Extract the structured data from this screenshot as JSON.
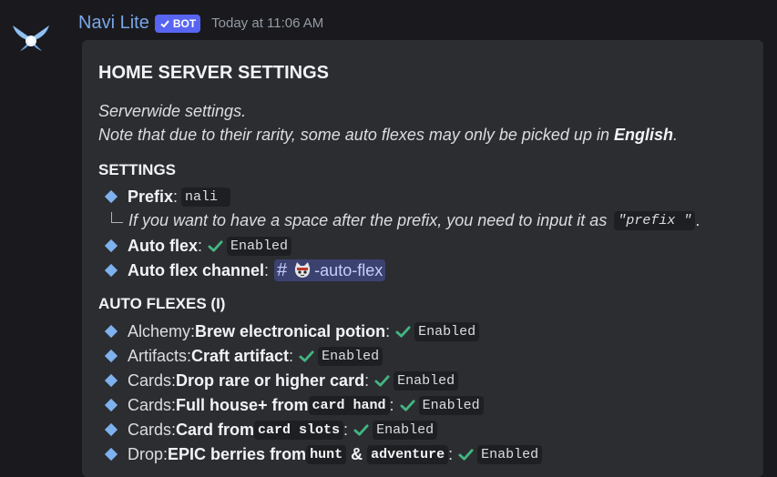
{
  "message": {
    "author": "Navi Lite",
    "bot_tag": "BOT",
    "timestamp": "Today at 11:06 AM"
  },
  "embed": {
    "title": "HOME SERVER SETTINGS",
    "description_line1": "Serverwide settings.",
    "description_line2_prefix": "Note that due to their rarity, some auto flexes may only be picked up in ",
    "description_line2_bold": "English",
    "description_line2_suffix": ".",
    "settings_heading": "SETTINGS",
    "prefix_label": "Prefix",
    "prefix_value": "nali",
    "prefix_note_text": "If you want to have a space after the prefix, you need to input it as",
    "prefix_note_code": "\"prefix \"",
    "prefix_note_end": ".",
    "auto_flex_label": "Auto flex",
    "auto_flex_value": "Enabled",
    "auto_flex_channel_label": "Auto flex channel",
    "auto_flex_channel_name": "-auto-flex",
    "auto_flexes_heading": "AUTO FLEXES (I)",
    "colon": ":",
    "items": [
      {
        "category": "Alchemy: ",
        "name": "Brew electronical potion",
        "status": "Enabled"
      },
      {
        "category": "Artifacts: ",
        "name": "Craft artifact",
        "status": "Enabled"
      },
      {
        "category": "Cards: ",
        "name": "Drop rare or higher card",
        "status": "Enabled"
      },
      {
        "category": "Cards: ",
        "name": "Full house+ from ",
        "code1": "card hand",
        "status": "Enabled"
      },
      {
        "category": "Cards: ",
        "name": "Card from ",
        "code1": "card slots",
        "status": "Enabled"
      },
      {
        "category": "Drop: ",
        "name": "EPIC berries from ",
        "code1": "hunt",
        "amp": " & ",
        "code2": "adventure",
        "status": "Enabled"
      }
    ]
  },
  "colors": {
    "accent": "#5865f2",
    "author": "#7aa6e8",
    "check": "#43b581",
    "diamond": "#7eb1ee"
  }
}
